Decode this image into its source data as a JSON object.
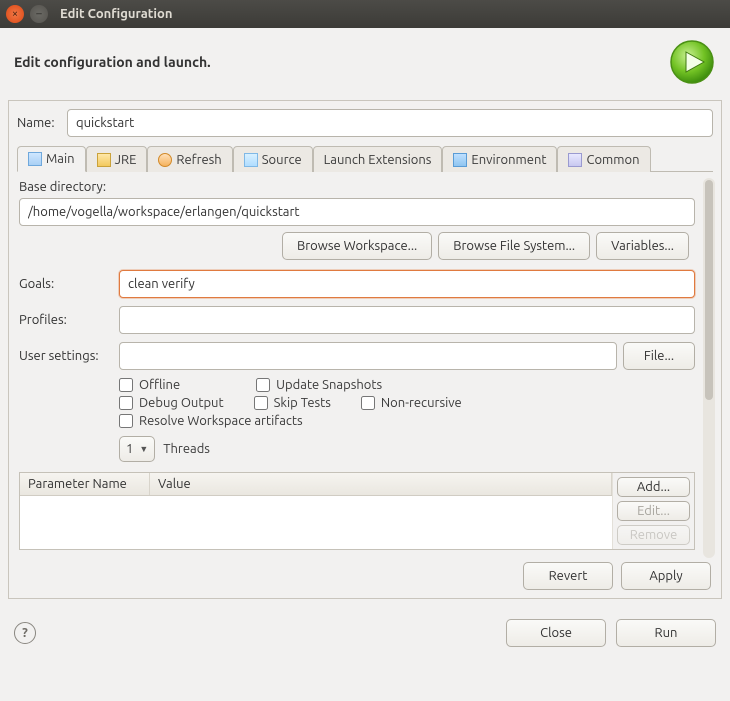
{
  "window": {
    "title": "Edit Configuration"
  },
  "header": {
    "title": "Edit configuration and launch."
  },
  "name": {
    "label": "Name:",
    "value": "quickstart"
  },
  "tabs": {
    "main": "Main",
    "jre": "JRE",
    "refresh": "Refresh",
    "source": "Source",
    "launch_ext": "Launch Extensions",
    "environment": "Environment",
    "common": "Common"
  },
  "main": {
    "base_dir_label": "Base directory:",
    "base_dir_value": "/home/vogella/workspace/erlangen/quickstart",
    "browse_ws": "Browse Workspace...",
    "browse_fs": "Browse File System...",
    "variables": "Variables...",
    "goals_label": "Goals:",
    "goals_value": "clean verify",
    "profiles_label": "Profiles:",
    "profiles_value": "",
    "user_settings_label": "User settings:",
    "user_settings_value": "",
    "file_btn": "File...",
    "checks": {
      "offline": "Offline",
      "update_snapshots": "Update Snapshots",
      "debug_output": "Debug Output",
      "skip_tests": "Skip Tests",
      "non_recursive": "Non-recursive",
      "resolve_ws": "Resolve Workspace artifacts"
    },
    "threads": {
      "value": "1",
      "label": "Threads"
    },
    "table": {
      "col_param": "Parameter Name",
      "col_value": "Value",
      "add": "Add...",
      "edit": "Edit...",
      "remove": "Remove"
    }
  },
  "footer": {
    "revert": "Revert",
    "apply": "Apply"
  },
  "bottom": {
    "close": "Close",
    "run": "Run"
  }
}
